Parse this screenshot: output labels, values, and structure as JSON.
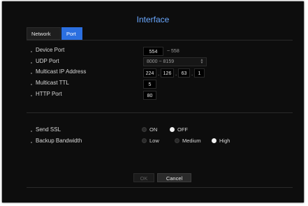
{
  "dialog": {
    "title": "Interface"
  },
  "tabs": [
    {
      "label": "Network",
      "active": false
    },
    {
      "label": "Port",
      "active": true
    }
  ],
  "fields": {
    "device_port": {
      "label": "Device Port",
      "value": "554",
      "range_suffix": "~ 558"
    },
    "udp_port": {
      "label": "UDP Port",
      "value": "8000 ~ 8159"
    },
    "multicast_ip": {
      "label": "Multicast IP Address",
      "octets": [
        "224",
        "126",
        "63",
        "1"
      ]
    },
    "multicast_ttl": {
      "label": "Multicast TTL",
      "value": "5"
    },
    "http_port": {
      "label": "HTTP Port",
      "value": "80"
    },
    "send_ssl": {
      "label": "Send SSL",
      "options": [
        "ON",
        "OFF"
      ],
      "selected": "OFF"
    },
    "backup_bandwidth": {
      "label": "Backup Bandwidth",
      "options": [
        "Low",
        "Medium",
        "High"
      ],
      "selected": "High"
    }
  },
  "buttons": {
    "ok": "OK",
    "cancel": "Cancel"
  },
  "colors": {
    "accent": "#2b6fe0",
    "title": "#6aa8ff",
    "background": "#0d0d0d"
  }
}
